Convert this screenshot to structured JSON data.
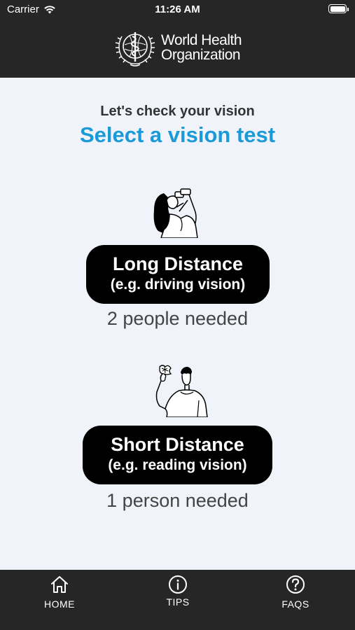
{
  "status_bar": {
    "carrier": "Carrier",
    "time": "11:26 AM"
  },
  "header": {
    "org_name_line1": "World Health",
    "org_name_line2": "Organization"
  },
  "main": {
    "subtitle": "Let's check your vision",
    "title": "Select a vision test",
    "title_color": "#1a9ad6",
    "tests": [
      {
        "label": "Long Distance",
        "sublabel": "(e.g. driving vision)",
        "people_needed": "2 people needed",
        "illustration": "woman-looking-through-binoculars"
      },
      {
        "label": "Short Distance",
        "sublabel": "(e.g. reading vision)",
        "people_needed": "1 person needed",
        "illustration": "man-holding-card"
      }
    ]
  },
  "tabbar": {
    "items": [
      {
        "label": "HOME",
        "icon": "home-icon"
      },
      {
        "label": "TIPS",
        "icon": "info-icon"
      },
      {
        "label": "FAQS",
        "icon": "question-icon"
      }
    ]
  }
}
